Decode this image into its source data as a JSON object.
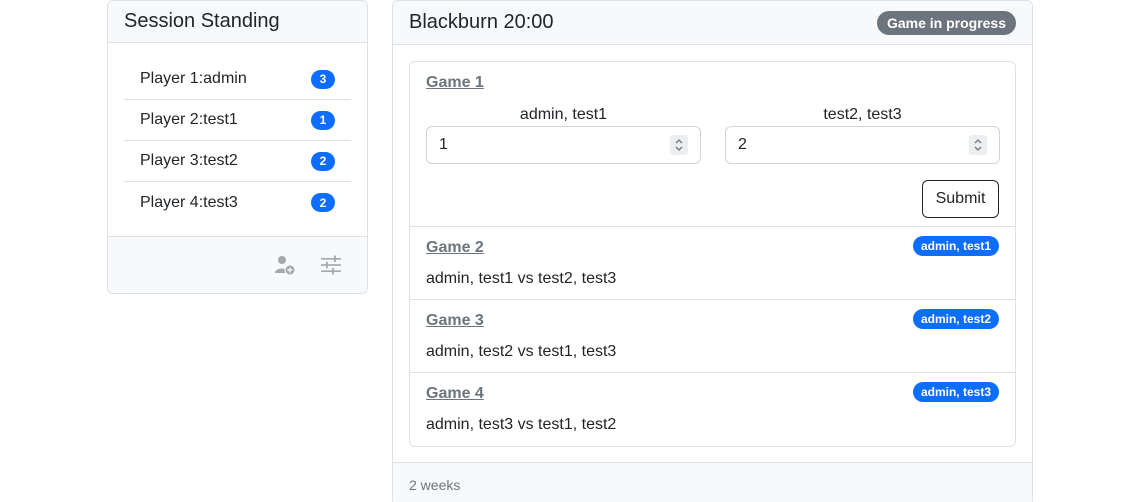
{
  "standing": {
    "title": "Session Standing",
    "players": [
      {
        "label": "Player 1:admin",
        "score": "3"
      },
      {
        "label": "Player 2:test1",
        "score": "1"
      },
      {
        "label": "Player 3:test2",
        "score": "2"
      },
      {
        "label": "Player 4:test3",
        "score": "2"
      }
    ],
    "footer_icons": [
      "add-player-icon",
      "settings-sliders-icon"
    ]
  },
  "session": {
    "title": "Blackburn 20:00",
    "status": "Game in progress",
    "active_game": {
      "title": "Game 1",
      "team1": "admin, test1",
      "team2": "test2, test3",
      "score1": "1",
      "score2": "2",
      "submit_label": "Submit"
    },
    "games": [
      {
        "title": "Game 2",
        "winner": "admin, test1",
        "matchup": "admin, test1 vs test2, test3"
      },
      {
        "title": "Game 3",
        "winner": "admin, test2",
        "matchup": "admin, test2 vs test1, test3"
      },
      {
        "title": "Game 4",
        "winner": "admin, test3",
        "matchup": "admin, test3 vs test1, test2"
      }
    ],
    "footer": "2 weeks"
  },
  "colors": {
    "primary": "#0d6efd",
    "secondary": "#6c757d",
    "header_bg": "#f8f9fa",
    "border": "#dee2e6"
  }
}
